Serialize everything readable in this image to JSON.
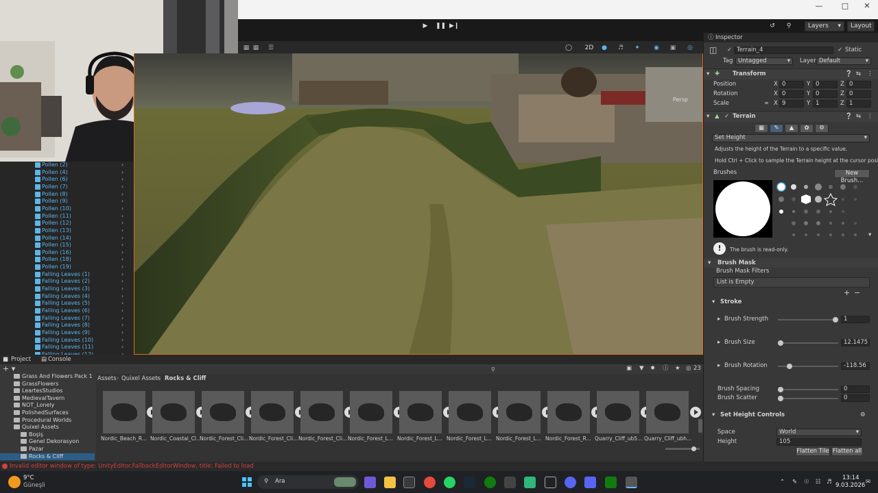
{
  "toolbar": {
    "layers_label": "Layers",
    "layout_label": "Layout",
    "mode_2d": "2D",
    "persp_label": "Persp"
  },
  "hierarchy": {
    "items": [
      "Pollen (2)",
      "Pollen (4)",
      "Pollen (6)",
      "Pollen (7)",
      "Pollen (8)",
      "Pollen (9)",
      "Pollen (10)",
      "Pollen (11)",
      "Pollen (12)",
      "Pollen (13)",
      "Pollen (14)",
      "Pollen (15)",
      "Pollen (16)",
      "Pollen (18)",
      "Pollen (19)",
      "Falling Leaves (1)",
      "Falling Leaves (2)",
      "Falling Leaves (3)",
      "Falling Leaves (4)",
      "Falling Leaves (5)",
      "Falling Leaves (6)",
      "Falling Leaves (7)",
      "Falling Leaves (8)",
      "Falling Leaves (9)",
      "Falling Leaves (10)",
      "Falling Leaves (11)",
      "Falling Leaves (12)"
    ]
  },
  "inspector": {
    "tab_label": "Inspector",
    "object_name": "Terrain_4",
    "static_label": "Static",
    "tag_label": "Tag",
    "tag_value": "Untagged",
    "layer_label": "Layer",
    "layer_value": "Default",
    "transform": {
      "title": "Transform",
      "position_label": "Position",
      "rotation_label": "Rotation",
      "scale_label": "Scale",
      "position": {
        "x": "0",
        "y": "0",
        "z": "0"
      },
      "rotation": {
        "x": "0",
        "y": "0",
        "z": "0"
      },
      "scale": {
        "x": "9",
        "y": "1",
        "z": "1"
      }
    },
    "terrain": {
      "title": "Terrain",
      "tool_dropdown": "Set Height",
      "help_line1": "Adjusts the height of the Terrain to a specific value.",
      "help_line2": "Hold Ctrl + Click to sample the Terrain height at the cursor position.",
      "brushes_label": "Brushes",
      "new_brush_label": "New Brush...",
      "readonly_note": "The brush is read-only.",
      "brush_mask_title": "Brush Mask",
      "brush_mask_filters": "Brush Mask Filters",
      "list_empty": "List is Empty",
      "stroke_title": "Stroke",
      "brush_strength_label": "Brush Strength",
      "brush_strength_value": "1",
      "brush_size_label": "Brush Size",
      "brush_size_value": "12.1475",
      "brush_rotation_label": "Brush Rotation",
      "brush_rotation_value": "-118.56",
      "brush_spacing_label": "Brush Spacing",
      "brush_spacing_value": "0",
      "brush_scatter_label": "Brush Scatter",
      "brush_scatter_value": "0",
      "set_height_controls": "Set Height Controls",
      "space_label": "Space",
      "space_value": "World",
      "height_label": "Height",
      "height_value": "105",
      "flatten_tile": "Flatten Tile",
      "flatten_all": "Flatten all"
    },
    "sliders": {
      "brush_strength": 1.0,
      "brush_size": 0.0,
      "brush_rotation": 0.17,
      "brush_spacing": 0.0,
      "brush_scatter": 0.0
    }
  },
  "project": {
    "tab_project": "Project",
    "tab_console": "Console",
    "breadcrumb": [
      "Assets",
      "Quixel Assets",
      "Rocks & Cliff"
    ],
    "item_count": "23",
    "folders": [
      "Grass And Flowers Pack 1",
      "GrassFlowers",
      "LeartesStudios",
      "MedievalTavern",
      "NOT_Lonely",
      "PolishedSurfaces",
      "Procedural Worlds",
      "Quixel Assets",
      "Boşiş",
      "Genel Dekorasyon",
      "Pazar",
      "Rocks & Cliff"
    ],
    "assets": [
      "Nordic_Beach_R...",
      "Nordic_Coastal_Cl...",
      "Nordic_Forest_Cli...",
      "Nordic_Forest_Cli...",
      "Nordic_Forest_Cli...",
      "Nordic_Forest_L...",
      "Nordic_Forest_L...",
      "Nordic_Forest_L...",
      "Nordic_Forest_L...",
      "Nordic_Forest_R...",
      "Quarry_Cliff_ub5...",
      "Quarry_Cliff_ubh..."
    ]
  },
  "status": {
    "message": "Invalid editor window of type: UnityEditor.FallbackEditorWindow, title: Failed to load"
  },
  "taskbar": {
    "weather_temp": "9°C",
    "weather_city": "Güneşli",
    "search_placeholder": "Ara",
    "time": "13:14",
    "date": "9.03.2026"
  }
}
